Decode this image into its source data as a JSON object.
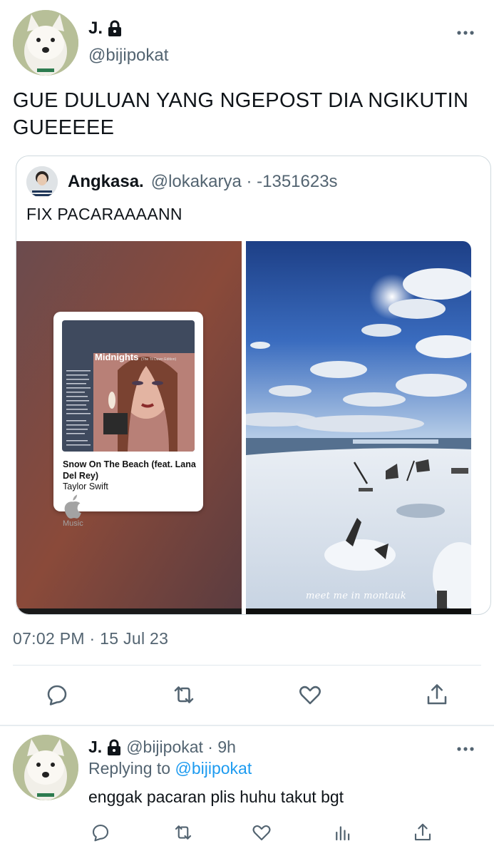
{
  "main_tweet": {
    "display_name": "J.",
    "handle": "@bijipokat",
    "text": "GUE DULUAN YANG NGEPOST DIA NGIKUTIN GUEEEEE",
    "timestamp": "07:02 PM · 15 Jul 23"
  },
  "quoted_tweet": {
    "display_name": "Angkasa.",
    "handle": "@lokakarya · -1351623s",
    "text": "FIX PACARAAAANN",
    "music_card": {
      "album_title": "Midnights",
      "album_subtitle": "(The Til Dawn Edition)",
      "song_title": "Snow On The Beach (feat. Lana Del Rey)",
      "artist": "Taylor Swift",
      "brand": "Music"
    },
    "photo_caption": "meet me in montauk"
  },
  "reply_tweet": {
    "display_name": "J.",
    "meta": "@bijipokat · 9h",
    "replying_to_label": "Replying to",
    "replying_to_mention": "@bijipokat",
    "text": "enggak pacaran plis huhu takut bgt"
  },
  "icons": {
    "lock": "lock-icon",
    "more": "more-dots-icon",
    "reply": "reply-bubble-icon",
    "retweet": "retweet-icon",
    "like": "heart-icon",
    "share": "share-icon",
    "analytics": "analytics-bars-icon"
  },
  "colors": {
    "text": "#0f1419",
    "secondary": "#536471",
    "accent": "#1d9bf0",
    "border": "#cfd9de"
  }
}
